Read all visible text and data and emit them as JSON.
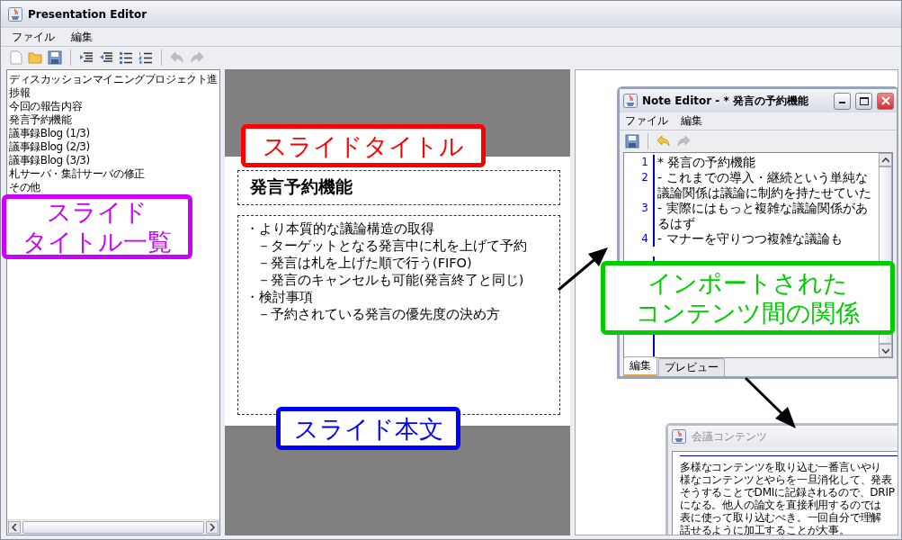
{
  "window": {
    "title": "Presentation Editor"
  },
  "menu": [
    "ファイル",
    "編集"
  ],
  "toolbar": [
    {
      "kind": "new",
      "disabled": false
    },
    {
      "kind": "open",
      "disabled": false
    },
    {
      "kind": "save",
      "disabled": false
    },
    {
      "kind": "sep"
    },
    {
      "kind": "indent",
      "disabled": false
    },
    {
      "kind": "outdent",
      "disabled": false
    },
    {
      "kind": "bullets",
      "disabled": false
    },
    {
      "kind": "numbers",
      "disabled": false
    },
    {
      "kind": "sep"
    },
    {
      "kind": "undo",
      "disabled": true
    },
    {
      "kind": "redo",
      "disabled": true
    }
  ],
  "slide_list": [
    "ディスカッションマイニングプロジェクト進捗報",
    "今回の報告内容",
    "発言予約機能",
    "議事録Blog (1/3)",
    "議事録Blog (2/3)",
    "議事録Blog (3/3)",
    "札サーバ・集計サーバの修正",
    "その他"
  ],
  "slide": {
    "title": "発言予約機能",
    "body": [
      {
        "marker": "・",
        "text": "より本質的な議論構造の取得",
        "children": [
          {
            "marker": "－",
            "text": "ターゲットとなる発言中に札を上げて予約"
          },
          {
            "marker": "－",
            "text": "発言は札を上げた順で行う(FIFO)"
          },
          {
            "marker": "－",
            "text": "発言のキャンセルも可能(発言終了と同じ)"
          }
        ]
      },
      {
        "marker": "・",
        "text": "検討事項",
        "children": [
          {
            "marker": "－",
            "text": "予約されている発言の優先度の決め方"
          }
        ]
      }
    ]
  },
  "note_editor": {
    "title": "Note Editor - * 発言の予約機能",
    "menu": [
      "ファイル",
      "編集"
    ],
    "toolbar": [
      {
        "kind": "save",
        "disabled": false
      },
      {
        "kind": "sep"
      },
      {
        "kind": "undo",
        "disabled": false
      },
      {
        "kind": "redo",
        "disabled": true
      }
    ],
    "lines": [
      {
        "number": "1",
        "text": "*  発言の予約機能"
      },
      {
        "number": "2",
        "text": "-  これまでの導入・継続という単純な議論関係は議論に制約を持たせていた"
      },
      {
        "number": "3",
        "text": "-  実際にはもっと複雑な議論関係があるはず"
      },
      {
        "number": "4",
        "text": "-  マナーを守りつつ複雑な議論も"
      }
    ],
    "tabs": [
      {
        "label": "編集",
        "selected": true
      },
      {
        "label": "プレビュー",
        "selected": false
      }
    ]
  },
  "content_window": {
    "title": "会議コンテンツ",
    "lines": [
      "多様なコンテンツを取り込む一番言いやり",
      "様なコンテンツとやらを一旦消化して、発表",
      "そうすることでDMIに記録されるので、DRIP",
      "になる。他人の論文を直接利用するのでは",
      "表に使って取り込むべき。一回自分で理解",
      "話せるように加工することが大事。"
    ]
  },
  "callouts": [
    {
      "text": "スライドタイトル",
      "color": "#ff0000"
    },
    {
      "text": "スライドタイトル一覧",
      "color": "#cc00ff"
    },
    {
      "text": "スライド本文",
      "color": "#0000ff"
    },
    {
      "text": "インポートされたコンテンツ間の関係",
      "color": "#00cc00"
    }
  ]
}
